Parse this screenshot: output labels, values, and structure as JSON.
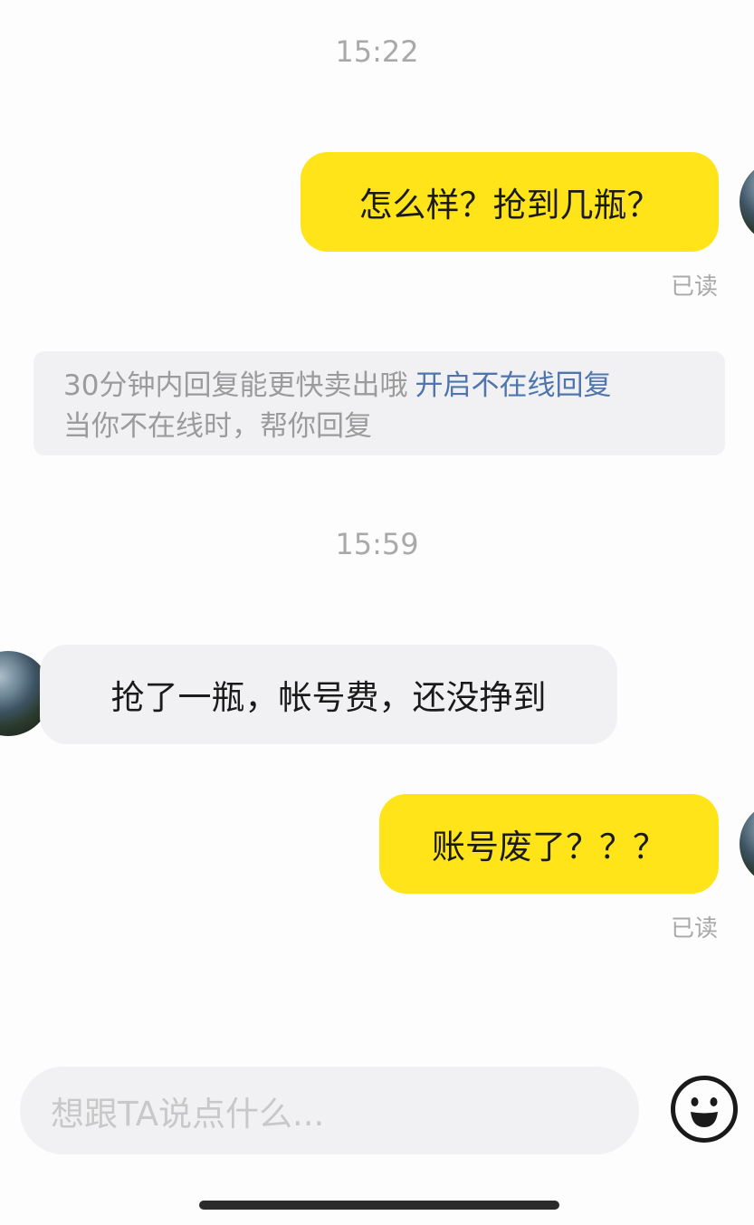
{
  "messages": {
    "time1": "15:22",
    "msg1": "怎么样？抢到几瓶？",
    "read1": "已读",
    "notice": {
      "text": "30分钟内回复能更快卖出哦",
      "link": "开启不在线回复",
      "sub": "当你不在线时，帮你回复"
    },
    "time2": "15:59",
    "msg2": "抢了一瓶，帐号费，还没挣到",
    "msg3": "账号废了？？？",
    "read3": "已读"
  },
  "input": {
    "placeholder": "想跟TA说点什么..."
  },
  "icons": {
    "emoji": "smiley-face-icon",
    "avatar": "landscape-avatar-image"
  },
  "colors": {
    "my_bubble": "#ffe41a",
    "their_bubble": "#f1f1f3",
    "link": "#4f75ad"
  }
}
